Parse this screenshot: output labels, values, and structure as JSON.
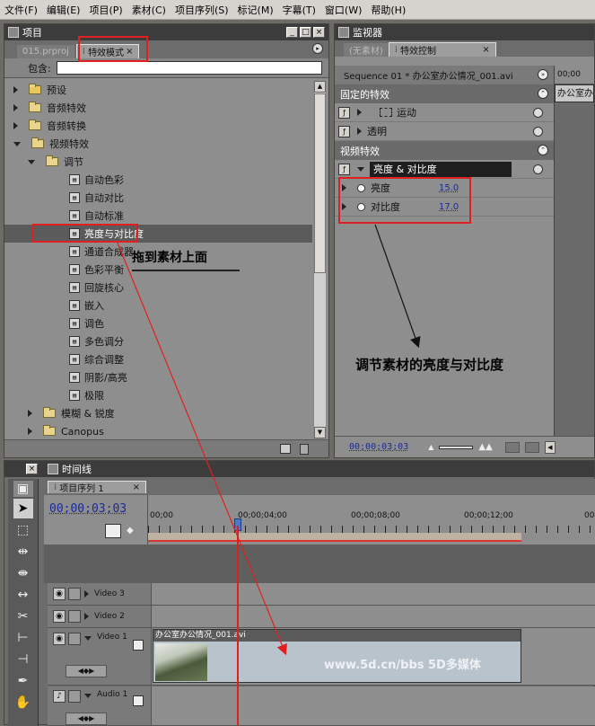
{
  "menu": [
    "文件(F)",
    "编辑(E)",
    "项目(P)",
    "素材(C)",
    "项目序列(S)",
    "标记(M)",
    "字幕(T)",
    "窗口(W)",
    "帮助(H)"
  ],
  "project_panel": {
    "title": "项目",
    "tabs": [
      "015.prproj",
      "特效模式"
    ],
    "tab_close": "×",
    "filter_label": "包含:",
    "filter_value": "",
    "tree": [
      {
        "label": "预设",
        "level": 0,
        "open": false,
        "kind": "folder-special"
      },
      {
        "label": "音频特效",
        "level": 0,
        "open": false,
        "kind": "folder"
      },
      {
        "label": "音频转换",
        "level": 0,
        "open": false,
        "kind": "folder"
      },
      {
        "label": "视频特效",
        "level": 0,
        "open": true,
        "kind": "folder"
      },
      {
        "label": "调节",
        "level": 1,
        "open": true,
        "kind": "folder"
      },
      {
        "label": "自动色彩",
        "level": 2,
        "kind": "effect"
      },
      {
        "label": "自动对比",
        "level": 2,
        "kind": "effect"
      },
      {
        "label": "自动标准",
        "level": 2,
        "kind": "effect"
      },
      {
        "label": "亮度与对比度",
        "level": 2,
        "kind": "effect",
        "selected": true
      },
      {
        "label": "通道合成器",
        "level": 2,
        "kind": "effect"
      },
      {
        "label": "色彩平衡",
        "level": 2,
        "kind": "effect"
      },
      {
        "label": "回旋核心",
        "level": 2,
        "kind": "effect"
      },
      {
        "label": "嵌入",
        "level": 2,
        "kind": "effect"
      },
      {
        "label": "调色",
        "level": 2,
        "kind": "effect"
      },
      {
        "label": "多色调分",
        "level": 2,
        "kind": "effect"
      },
      {
        "label": "综合调整",
        "level": 2,
        "kind": "effect"
      },
      {
        "label": "阴影/高亮",
        "level": 2,
        "kind": "effect"
      },
      {
        "label": "极限",
        "level": 2,
        "kind": "effect"
      },
      {
        "label": "模糊 & 锐度",
        "level": 1,
        "open": false,
        "kind": "folder"
      },
      {
        "label": "Canopus",
        "level": 1,
        "open": false,
        "kind": "folder"
      }
    ]
  },
  "annotations": {
    "drag_text": "拖到素材上面",
    "adjust_text": "调节素材的亮度与对比度",
    "watermark": "www.5d.cn/bbs  5D多媒体"
  },
  "monitor_panel": {
    "title": "监视器",
    "tabs": [
      "(无素材)",
      "特效控制"
    ],
    "tab_close": "×",
    "clip_name": "Sequence 01 * 办公室办公情况_001.avi",
    "mini_timecode": "00;00",
    "mini_clip": "办公室办",
    "fixed_effects": "固定的特效",
    "motion": "运动",
    "opacity": "透明",
    "video_effects": "视频特效",
    "effect_name": "亮度 & 对比度",
    "params": [
      {
        "label": "亮度",
        "value": "15.0"
      },
      {
        "label": "对比度",
        "value": "17.0"
      }
    ],
    "bottom_timecode": "00;00;03;03"
  },
  "timeline": {
    "title": "时间线",
    "tab": "项目序列 1",
    "tab_close": "×",
    "timecode": "00;00;03;03",
    "ruler": [
      "00;00",
      "00;00;04;00",
      "00;00;08;00",
      "00;00;12;00",
      "00;0"
    ],
    "tracks": [
      {
        "name": "Video 3"
      },
      {
        "name": "Video 2"
      },
      {
        "name": "Video 1"
      },
      {
        "name": "Audio 1"
      }
    ],
    "clip_name": "办公室办公情况_001.avi"
  },
  "colors": {
    "accent_red": "#e02020",
    "selection": "#5b5b5b",
    "panel": "#8e8e8e"
  }
}
